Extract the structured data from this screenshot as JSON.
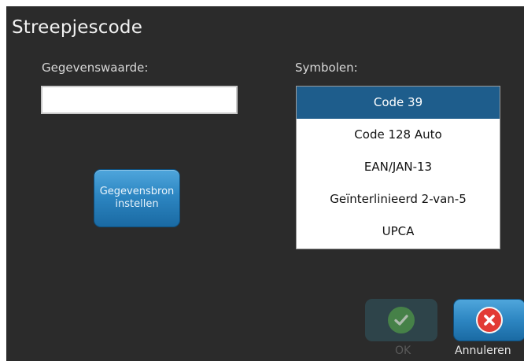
{
  "dialog": {
    "title": "Streepjescode"
  },
  "form": {
    "value_label": "Gegevenswaarde:",
    "value_input": "",
    "symbols_label": "Symbolen:"
  },
  "symbols": {
    "items": [
      "Code 39",
      "Code 128 Auto",
      "EAN/JAN-13",
      "Geïnterlinieerd 2-van-5",
      "UPCA"
    ],
    "selected": "Code 39"
  },
  "buttons": {
    "data_source": "Gegevensbron\ninstellen",
    "ok": "OK",
    "cancel": "Annuleren"
  },
  "icons": {
    "ok": "checkmark-icon",
    "cancel": "close-icon"
  },
  "colors": {
    "background": "#2b2b2b",
    "selection": "#1e5d8c",
    "button_blue": "#2d86c2",
    "ok_green": "#4f9e52",
    "cancel_red": "#e23a34"
  }
}
